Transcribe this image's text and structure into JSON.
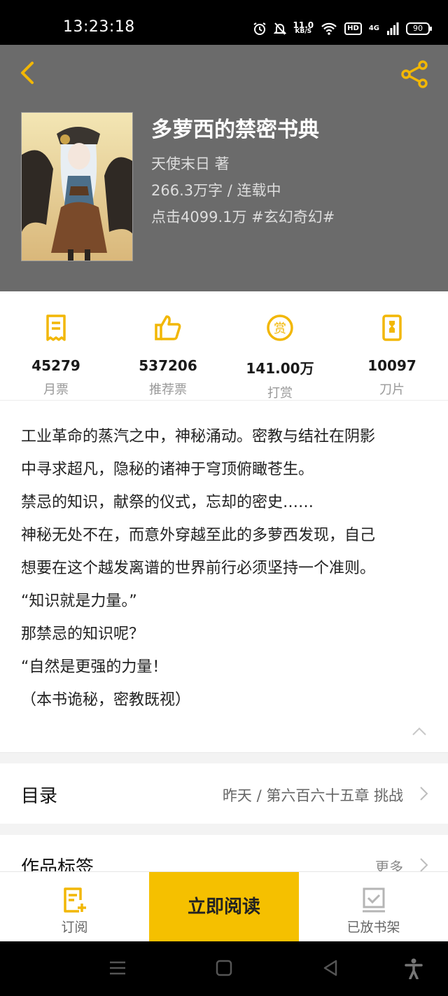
{
  "status_bar": {
    "time": "13:23:18",
    "net_speed_value": "11.0",
    "net_speed_unit": "KB/S",
    "hd_label": "HD",
    "network_label": "4G",
    "battery": "90"
  },
  "book": {
    "title": "多萝西的禁密书典",
    "author_line": "天使末日  著",
    "words_line": "266.3万字 / 连载中",
    "clicks_line": "点击4099.1万  #玄幻奇幻#"
  },
  "stats": [
    {
      "icon": "monthly-ticket-icon",
      "value": "45279",
      "label": "月票"
    },
    {
      "icon": "thumbs-up-icon",
      "value": "537206",
      "label": "推荐票"
    },
    {
      "icon": "reward-coin-icon",
      "value": "141.00万",
      "label": "打赏"
    },
    {
      "icon": "blade-icon",
      "value": "10097",
      "label": "刀片"
    }
  ],
  "intro": {
    "lines": [
      "工业革命的蒸汽之中，神秘涌动。密教与结社在阴影",
      "中寻求超凡，隐秘的诸神于穹顶俯瞰苍生。",
      "禁忌的知识，献祭的仪式，忘却的密史……",
      "神秘无处不在，而意外穿越至此的多萝西发现，自己",
      "想要在这个越发离谱的世界前行必须坚持一个准则。",
      "“知识就是力量。”",
      "那禁忌的知识呢？",
      "“自然是更强的力量！",
      "（本书诡秘，密教既视）"
    ]
  },
  "toc": {
    "title": "目录",
    "latest": "昨天 / 第六百六十五章 挑战"
  },
  "tags": {
    "title": "作品标签",
    "more": "更多"
  },
  "bottom_bar": {
    "subscribe": "订阅",
    "read_now": "立即阅读",
    "on_shelf": "已放书架"
  },
  "colors": {
    "accent": "#f5c000",
    "header_bg": "#6b6b6b",
    "icon_yellow": "#f2b705"
  }
}
